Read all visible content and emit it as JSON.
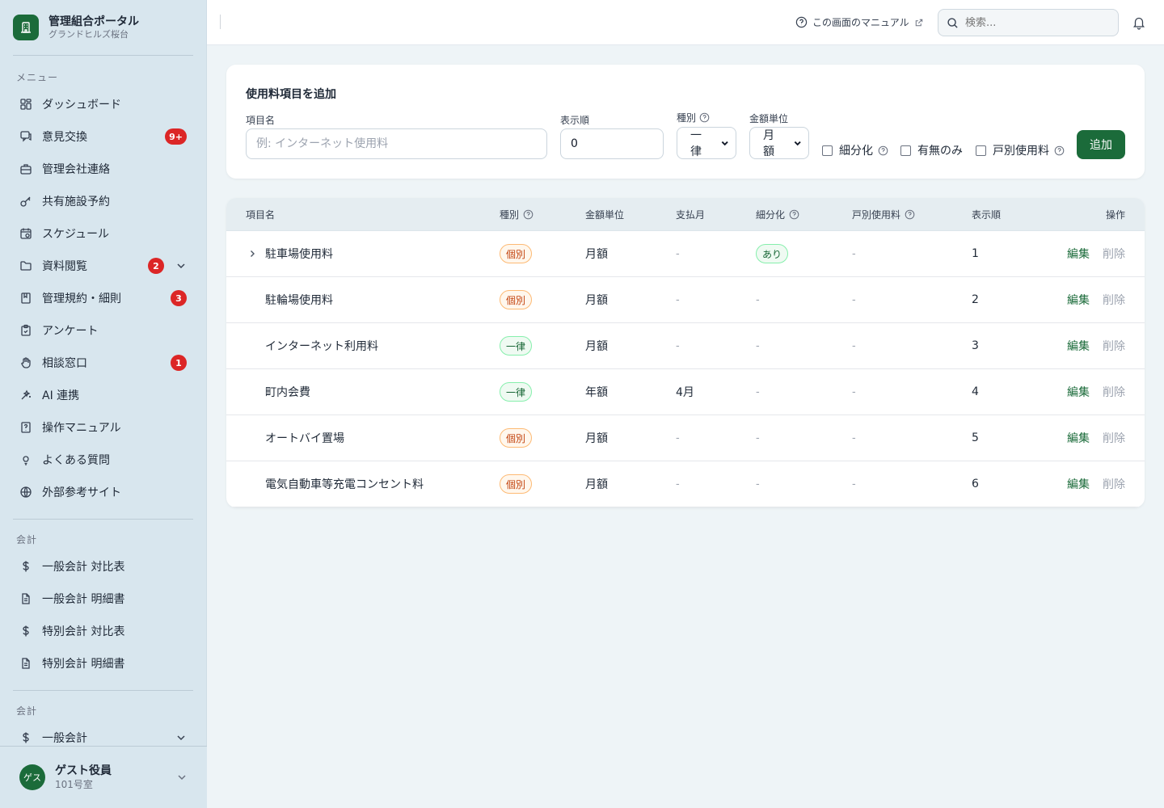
{
  "brand": {
    "title": "管理組合ポータル",
    "subtitle": "グランドヒルズ桜台"
  },
  "sidebar": {
    "menu_label": "メニュー",
    "items": [
      {
        "label": "ダッシュボード",
        "icon": "dashboard-icon"
      },
      {
        "label": "意見交換",
        "icon": "chat-icon",
        "badge": "9+"
      },
      {
        "label": "管理会社連絡",
        "icon": "briefcase-icon"
      },
      {
        "label": "共有施設予約",
        "icon": "key-icon"
      },
      {
        "label": "スケジュール",
        "icon": "calendar-icon"
      },
      {
        "label": "資料閲覧",
        "icon": "folder-icon",
        "badge": "2"
      },
      {
        "label": "管理規約・細則",
        "icon": "book-icon",
        "badge": "3"
      },
      {
        "label": "アンケート",
        "icon": "clipboard-icon"
      },
      {
        "label": "相談窓口",
        "icon": "hand-icon",
        "badge": "1"
      },
      {
        "label": "AI 連携",
        "icon": "sparkle-icon"
      },
      {
        "label": "操作マニュアル",
        "icon": "manual-icon"
      },
      {
        "label": "よくある質問",
        "icon": "lightbulb-icon"
      },
      {
        "label": "外部参考サイト",
        "icon": "globe-icon"
      }
    ],
    "accounting_label": "会計",
    "accounting_items": [
      {
        "label": "一般会計 対比表",
        "icon": "dollar-icon"
      },
      {
        "label": "一般会計 明細書",
        "icon": "document-icon"
      },
      {
        "label": "特別会計 対比表",
        "icon": "dollar-icon"
      },
      {
        "label": "特別会計 明細書",
        "icon": "document-icon"
      }
    ],
    "accounting2_label": "会計",
    "accounting2_items": [
      {
        "label": "一般会計",
        "icon": "dollar-icon"
      }
    ]
  },
  "user": {
    "avatar": "ゲス",
    "name": "ゲスト役員",
    "room": "101号室"
  },
  "topbar": {
    "manual_link": "この画面のマニュアル",
    "search_placeholder": "検索..."
  },
  "form": {
    "title": "使用料項目を追加",
    "name_label": "項目名",
    "name_placeholder": "例: インターネット使用料",
    "order_label": "表示順",
    "order_value": "0",
    "type_label": "種別",
    "type_value": "一律",
    "unit_label": "金額単位",
    "unit_value": "月額",
    "check_subdivide": "細分化",
    "check_presence": "有無のみ",
    "check_per_unit": "戸別使用料",
    "add_button": "追加"
  },
  "table": {
    "headers": {
      "name": "項目名",
      "type": "種別",
      "unit": "金額単位",
      "pay_month": "支払月",
      "subdivide": "細分化",
      "per_unit": "戸別使用料",
      "order": "表示順",
      "actions": "操作"
    },
    "edit_label": "編集",
    "delete_label": "削除",
    "rows": [
      {
        "name": "駐車場使用料",
        "type": "個別",
        "unit": "月額",
        "pay_month": "-",
        "subdivide": "あり",
        "per_unit": "-",
        "order": "1",
        "expandable": true
      },
      {
        "name": "駐輪場使用料",
        "type": "個別",
        "unit": "月額",
        "pay_month": "-",
        "subdivide": "-",
        "per_unit": "-",
        "order": "2"
      },
      {
        "name": "インターネット利用料",
        "type": "一律",
        "unit": "月額",
        "pay_month": "-",
        "subdivide": "-",
        "per_unit": "-",
        "order": "3"
      },
      {
        "name": "町内会費",
        "type": "一律",
        "unit": "年額",
        "pay_month": "4月",
        "subdivide": "-",
        "per_unit": "-",
        "order": "4"
      },
      {
        "name": "オートバイ置場",
        "type": "個別",
        "unit": "月額",
        "pay_month": "-",
        "subdivide": "-",
        "per_unit": "-",
        "order": "5"
      },
      {
        "name": "電気自動車等充電コンセント料",
        "type": "個別",
        "unit": "月額",
        "pay_month": "-",
        "subdivide": "-",
        "per_unit": "-",
        "order": "6"
      }
    ]
  },
  "colors": {
    "brand": "#1b6b3a",
    "badge": "#dc2626",
    "sidebar_bg": "#d8e6ee",
    "content_bg": "#eef4f7"
  }
}
